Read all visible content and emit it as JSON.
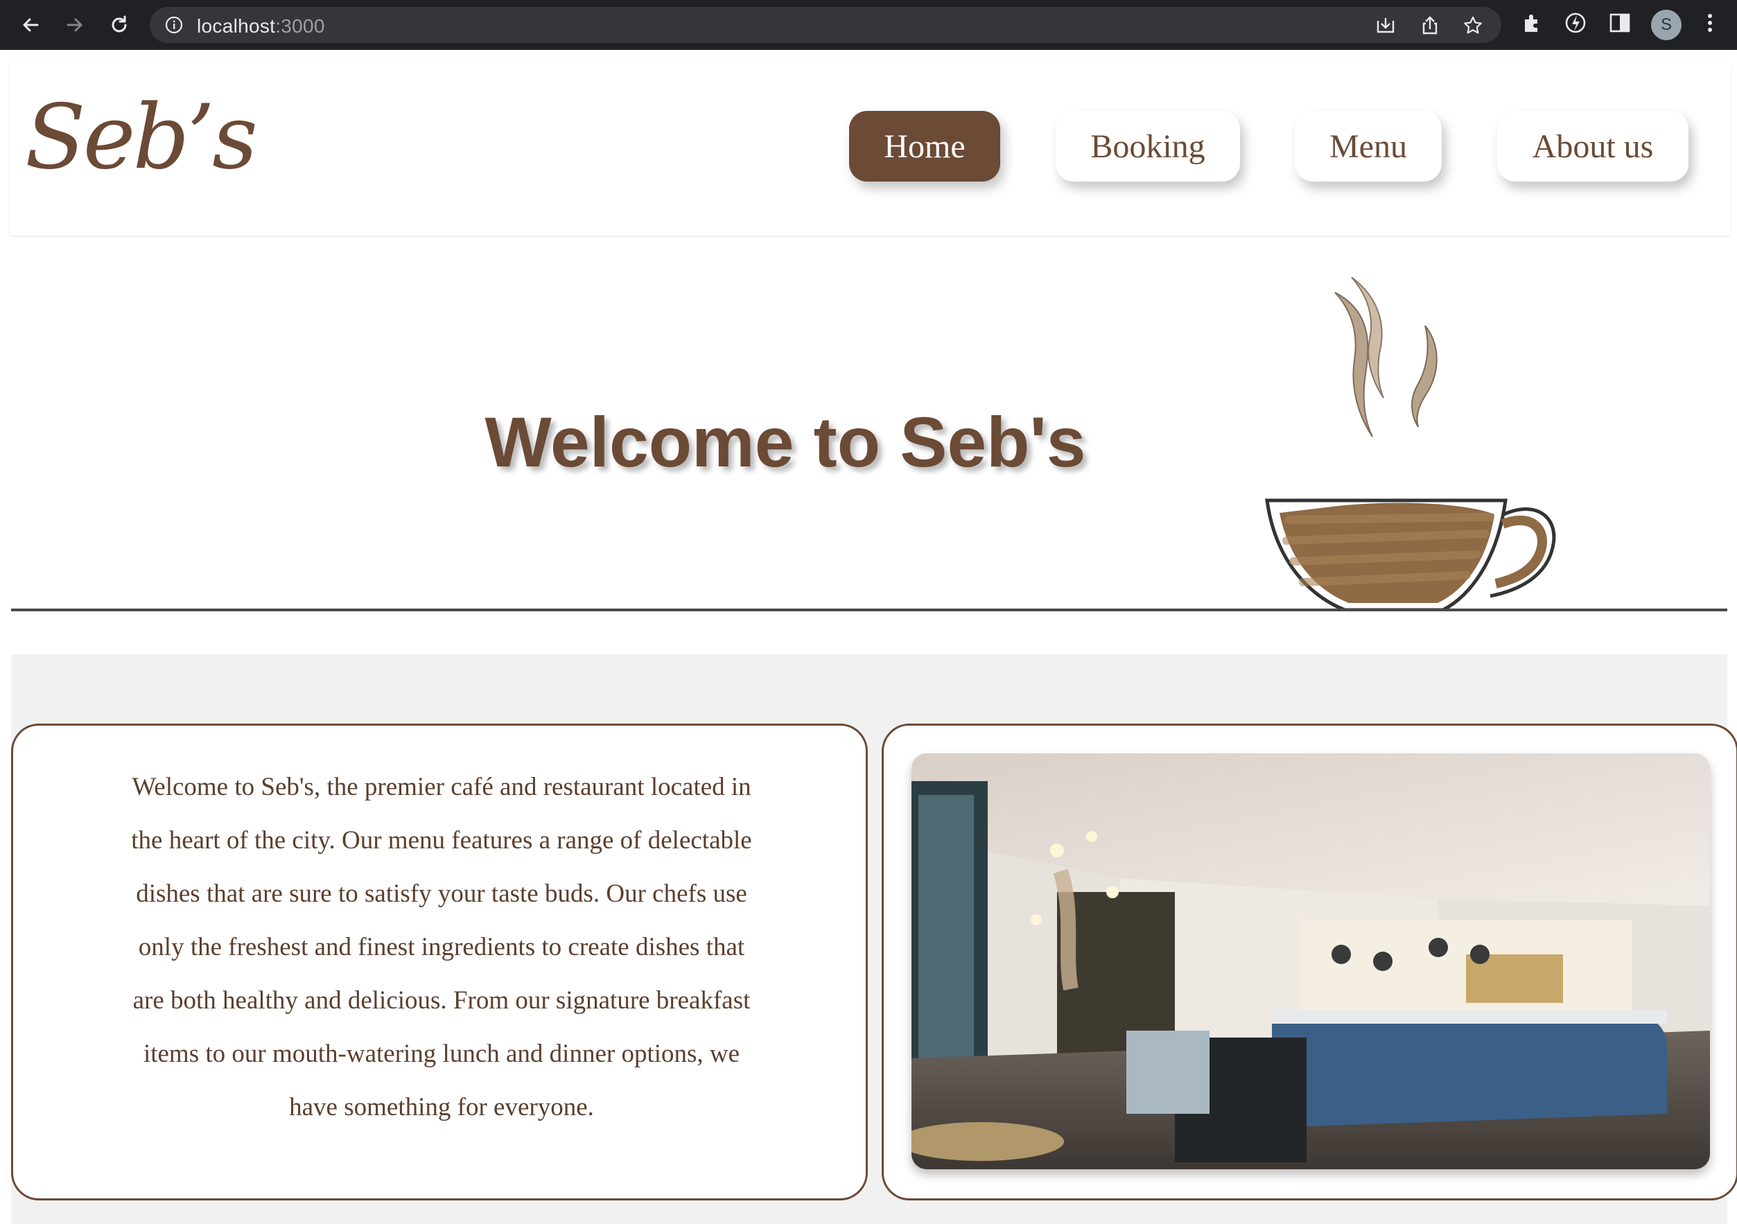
{
  "browser": {
    "url_host": "localhost",
    "url_port": ":3000",
    "profile_initial": "S"
  },
  "site": {
    "logo": "Seb’s",
    "nav": [
      {
        "label": "Home",
        "active": true
      },
      {
        "label": "Booking",
        "active": false
      },
      {
        "label": "Menu",
        "active": false
      },
      {
        "label": "About us",
        "active": false
      }
    ],
    "hero_title": "Welcome to Seb's",
    "intro_text": "Welcome to Seb's, the premier café and restaurant located in the heart of the city. Our menu features a range of delectable dishes that are sure to satisfy your taste buds. Our chefs use only the freshest and finest ingredients to create dishes that are both healthy and delicious. From our signature breakfast items to our mouth-watering lunch and dinner options, we have something for everyone."
  },
  "colors": {
    "brand_brown": "#6b4a36",
    "text_brown": "#5b3f2e",
    "content_bg": "#f1f1f1",
    "chrome_bg": "#202124"
  }
}
